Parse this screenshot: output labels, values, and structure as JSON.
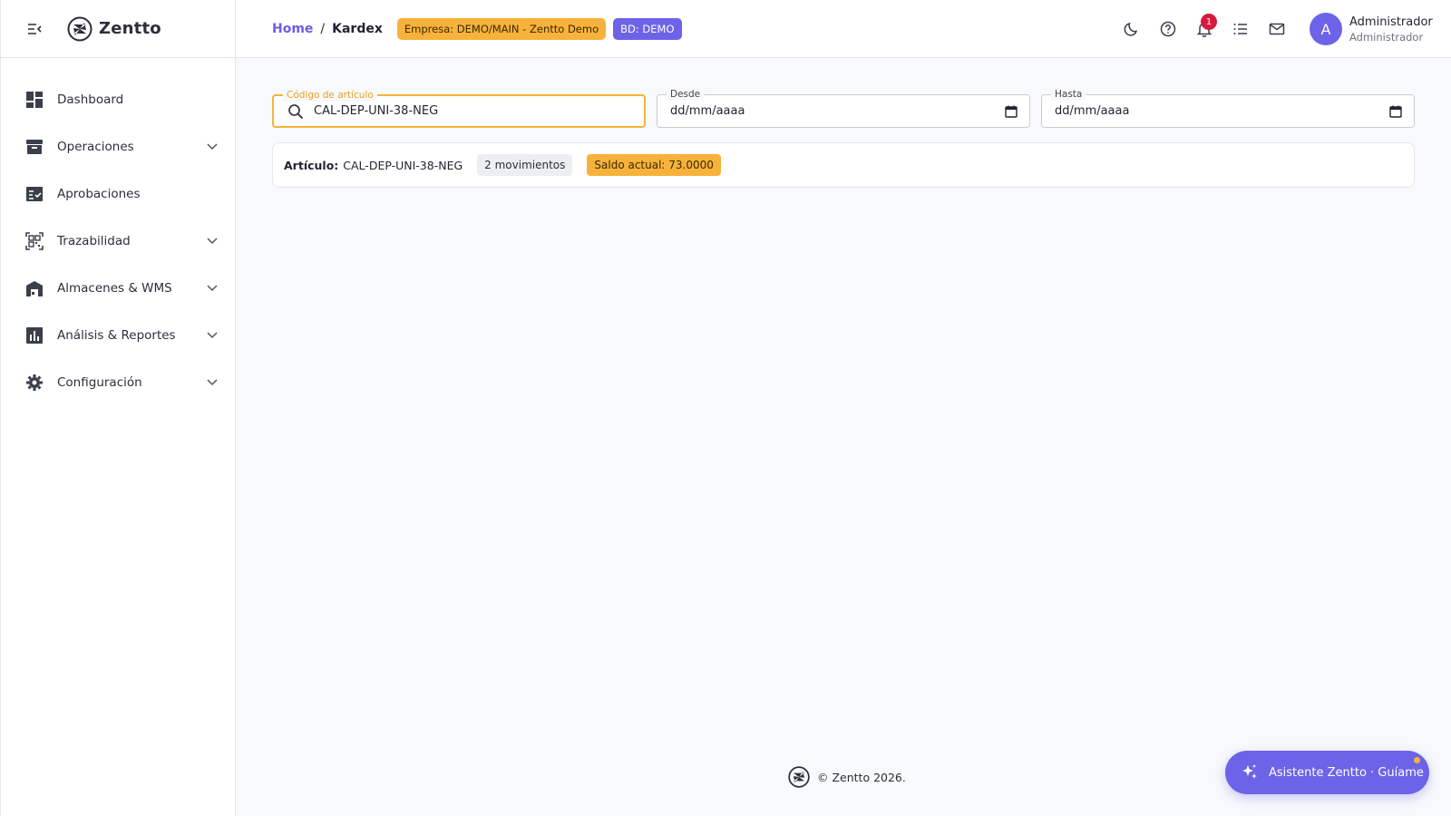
{
  "brand": {
    "name": "Zentto"
  },
  "sidebar": {
    "items": [
      {
        "label": "Dashboard",
        "icon": "dashboard-icon",
        "expandable": false
      },
      {
        "label": "Operaciones",
        "icon": "archive-icon",
        "expandable": true
      },
      {
        "label": "Aprobaciones",
        "icon": "checklist-icon",
        "expandable": false
      },
      {
        "label": "Trazabilidad",
        "icon": "qr-scan-icon",
        "expandable": true
      },
      {
        "label": "Almacenes & WMS",
        "icon": "warehouse-icon",
        "expandable": true
      },
      {
        "label": "Análisis & Reportes",
        "icon": "bar-chart-icon",
        "expandable": true
      },
      {
        "label": "Configuración",
        "icon": "gear-icon",
        "expandable": true
      }
    ]
  },
  "header": {
    "breadcrumb": {
      "home": "Home",
      "separator": "/",
      "current": "Kardex"
    },
    "empresa_badge": "Empresa: DEMO/MAIN - Zentto Demo",
    "bd_badge": "BD: DEMO",
    "notifications_count": "1",
    "user": {
      "initial": "A",
      "name": "Administrador",
      "role": "Administrador"
    }
  },
  "filters": {
    "codigo": {
      "label": "Código de artículo",
      "value": "CAL-DEP-UNI-38-NEG"
    },
    "desde": {
      "label": "Desde",
      "value": "dd/mm/aaaa"
    },
    "hasta": {
      "label": "Hasta",
      "value": "dd/mm/aaaa"
    }
  },
  "info": {
    "articulo_label": "Artículo:",
    "articulo_value": "CAL-DEP-UNI-38-NEG",
    "movimientos": "2 movimientos",
    "saldo": "Saldo actual: 73.0000"
  },
  "footer": {
    "text": "© Zentto 2026."
  },
  "assistant": {
    "label": "Asistente Zentto · Guíame"
  },
  "colors": {
    "accent": "#6c63e8",
    "warning": "#f7b23b",
    "danger": "#d81b3c"
  }
}
